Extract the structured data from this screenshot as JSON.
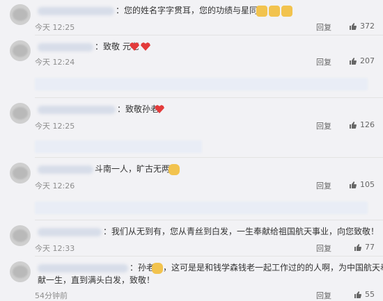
{
  "comments": [
    {
      "text": "：您的姓名字字贯耳，您的功绩与星同恒",
      "time": "今天 12:25",
      "reply": "回复",
      "likes": "372",
      "emoji": "thumbs-up-x3"
    },
    {
      "text": "：致敬 元老",
      "time": "今天 12:24",
      "reply": "回复",
      "likes": "207",
      "emoji": "hearts-x2"
    },
    {
      "text": "：致敬孙老",
      "time": "今天 12:25",
      "reply": "回复",
      "likes": "126",
      "emoji": "heart"
    },
    {
      "text": "斗南一人，旷古无两",
      "time": "今天 12:26",
      "reply": "回复",
      "likes": "105",
      "emoji": "pray"
    },
    {
      "text": "：我们从无到有，您从青丝到白发，一生奉献给祖国航天事业，向您致敬！",
      "time": "今天 12:33",
      "reply": "回复",
      "likes": "77",
      "emoji": ""
    },
    {
      "text_a": "：孙老",
      "text_b": "，这可是是和钱学森钱老一起工作过的的人啊，为中国航天奉",
      "text_c": "献一生，直到满头白发，致敬！",
      "time": "54分钟前",
      "reply": "回复",
      "likes": "55",
      "emoji": "pray"
    }
  ],
  "icons": {
    "like": "thumbs-up-icon",
    "thumbs": "thumbs-up-emoji-icon",
    "heart": "heart-emoji-icon",
    "pray": "pray-emoji-icon"
  }
}
